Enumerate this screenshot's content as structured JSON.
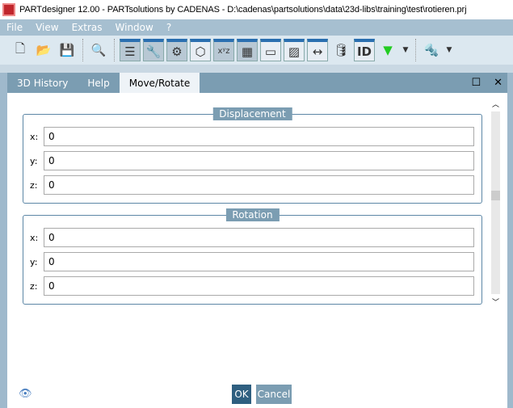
{
  "title": "PARTdesigner 12.00 - PARTsolutions by CADENAS - D:\\cadenas\\partsolutions\\data\\23d-libs\\training\\test\\rotieren.prj",
  "menu": [
    "File",
    "View",
    "Extras",
    "Window",
    "?"
  ],
  "tabs": [
    "3D History",
    "Help",
    "Move/Rotate"
  ],
  "displacement": {
    "title": "Displacement",
    "fields": [
      {
        "label": "x:",
        "value": "0"
      },
      {
        "label": "y:",
        "value": "0"
      },
      {
        "label": "z:",
        "value": "0"
      }
    ]
  },
  "rotation": {
    "title": "Rotation",
    "fields": [
      {
        "label": "x:",
        "value": "0"
      },
      {
        "label": "y:",
        "value": "0"
      },
      {
        "label": "z:",
        "value": "0"
      }
    ]
  },
  "buttons": {
    "ok": "OK",
    "cancel": "Cancel"
  },
  "colors": {
    "accent": "#2f5f80",
    "tab_bar": "#7b9db2"
  }
}
